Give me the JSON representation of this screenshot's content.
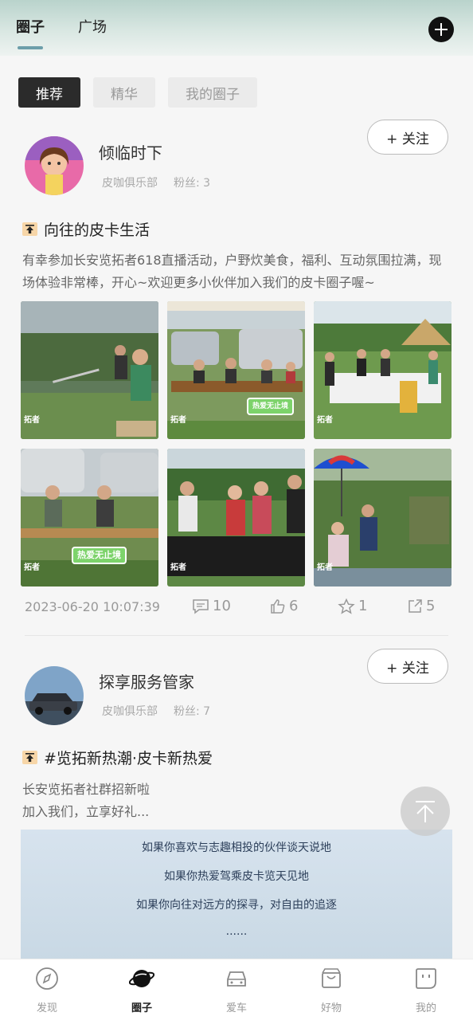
{
  "header": {
    "tabs": [
      {
        "label": "圈子",
        "active": true
      },
      {
        "label": "广场",
        "active": false
      }
    ],
    "add_icon": "plus-circle-icon"
  },
  "filters": [
    {
      "label": "推荐",
      "active": true
    },
    {
      "label": "精华",
      "active": false
    },
    {
      "label": "我的圈子",
      "active": false
    }
  ],
  "posts": [
    {
      "author": "倾临时下",
      "club": "皮咖俱乐部",
      "fans": "粉丝: 3",
      "follow_label": "+ 关注",
      "title": "向往的皮卡生活",
      "body": "有幸参加长安览拓者618直播活动，户野炊美食，福利、互动氛围拉满，现场体验非常棒，开心~欢迎更多小伙伴加入我们的皮卡圈子喔~",
      "photo_watermark": "拓者",
      "photo_badge": "热爱无止境",
      "date": "2023-06-20 10:07:39",
      "comments": "10",
      "likes": "6",
      "stars": "1",
      "shares": "5"
    },
    {
      "author": "探享服务管家",
      "club": "皮咖俱乐部",
      "fans": "粉丝: 7",
      "follow_label": "+ 关注",
      "title": "#览拓新热潮·皮卡新热爱",
      "body_line1": "长安览拓者社群招新啦",
      "body_line2": "加入我们，立享好礼...",
      "banner_lines": [
        "如果你喜欢与志趣相投的伙伴谈天说地",
        "如果你热爱驾乘皮卡览天见地",
        "如果你向往对远方的探寻，对自由的追逐",
        "......"
      ]
    }
  ],
  "bottom_nav": [
    {
      "label": "发现",
      "icon": "compass-icon"
    },
    {
      "label": "圈子",
      "icon": "planet-icon",
      "active": true
    },
    {
      "label": "爱车",
      "icon": "car-icon"
    },
    {
      "label": "好物",
      "icon": "shopping-bag-icon"
    },
    {
      "label": "我的",
      "icon": "profile-face-icon"
    }
  ],
  "colors": {
    "accent": "#6c9eaa",
    "active_chip": "#2b2b2b",
    "badge_green": "#7dd36b"
  }
}
